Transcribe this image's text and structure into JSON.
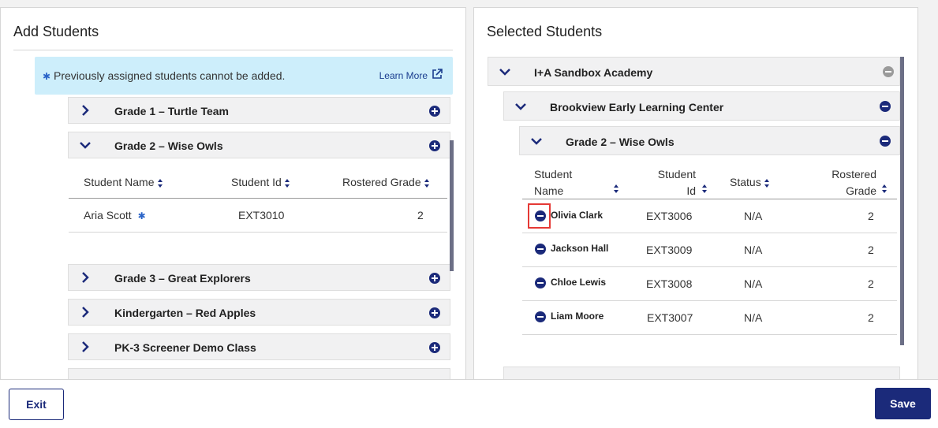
{
  "left": {
    "title": "Add Students",
    "notice": {
      "text": "Previously assigned students cannot be added.",
      "learn_more": "Learn More"
    },
    "groups": [
      {
        "label": "Grade 1 – Turtle Team"
      },
      {
        "label": "Grade 2 – Wise Owls"
      },
      {
        "label": "Grade 3 – Great Explorers"
      },
      {
        "label": "Kindergarten – Red Apples"
      },
      {
        "label": "PK-3 Screener Demo Class"
      }
    ],
    "columns": {
      "name": "Student Name",
      "id": "Student Id",
      "grade": "Rostered Grade"
    },
    "students": [
      {
        "name": "Aria Scott",
        "id": "EXT3010",
        "grade": "2"
      }
    ]
  },
  "right": {
    "title": "Selected Students",
    "school": "I+A Sandbox Academy",
    "center": "Brookview Early Learning Center",
    "class": "Grade 2 – Wise Owls",
    "columns": {
      "name_1": "Student",
      "name_2": "Name",
      "id_1": "Student",
      "id_2": "Id",
      "status": "Status",
      "grade_1": "Rostered",
      "grade_2": "Grade"
    },
    "students": [
      {
        "name": "Olivia Clark",
        "id": "EXT3006",
        "status": "N/A",
        "grade": "2"
      },
      {
        "name": "Jackson Hall",
        "id": "EXT3009",
        "status": "N/A",
        "grade": "2"
      },
      {
        "name": "Chloe Lewis",
        "id": "EXT3008",
        "status": "N/A",
        "grade": "2"
      },
      {
        "name": "Liam Moore",
        "id": "EXT3007",
        "status": "N/A",
        "grade": "2"
      }
    ]
  },
  "footer": {
    "exit": "Exit",
    "save": "Save"
  },
  "colors": {
    "accent": "#1b2a7a",
    "notice_bg": "#cdeefb",
    "highlight": "#e53935"
  }
}
